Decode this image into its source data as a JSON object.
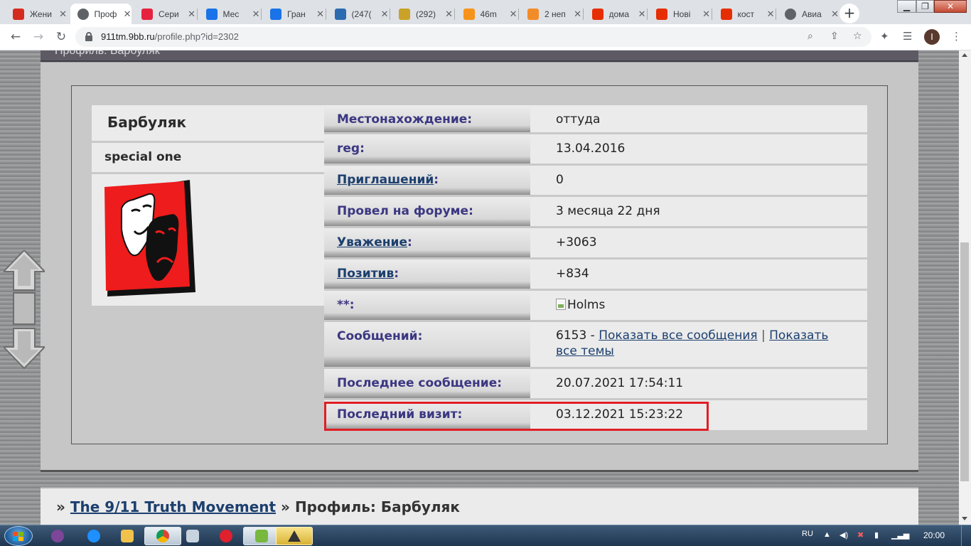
{
  "browser": {
    "tabs": [
      {
        "label": "Жени",
        "favicon": "flag-ru-icon",
        "color": "#d52b1e"
      },
      {
        "label": "Проф",
        "favicon": "globe-icon",
        "color": "#5f6368",
        "active": true
      },
      {
        "label": "Сери",
        "favicon": "ivi-icon",
        "color": "#e5233f"
      },
      {
        "label": "Мес",
        "favicon": "messenger-icon",
        "color": "#1a73e8"
      },
      {
        "label": "Гран",
        "favicon": "mail-at-icon",
        "color": "#1a73e8"
      },
      {
        "label": "(247(",
        "favicon": "mail-envelope-icon",
        "color": "#2b6cb0"
      },
      {
        "label": "(292)",
        "favicon": "shield-icon",
        "color": "#c9a227"
      },
      {
        "label": "46m",
        "favicon": "bitcoin-icon",
        "color": "#f7931a"
      },
      {
        "label": "2 неп",
        "favicon": "mail-envelope-icon",
        "color": "#f28c28"
      },
      {
        "label": "дома",
        "favicon": "aliexpress-icon",
        "color": "#e62e04"
      },
      {
        "label": "Нові",
        "favicon": "aliexpress-icon",
        "color": "#e62e04"
      },
      {
        "label": "кост",
        "favicon": "aliexpress-icon",
        "color": "#e62e04"
      },
      {
        "label": "Авиа",
        "favicon": "globe-icon",
        "color": "#5f6368"
      }
    ],
    "close_glyph": "✕",
    "new_tab_glyph": "+",
    "url_host": "911tm.9bb.ru",
    "url_path": "/profile.php?id=2302",
    "profile_initial": "I"
  },
  "profile_header": {
    "title": "Профиль: Барбуляк"
  },
  "profile": {
    "username": "Барбуляк",
    "user_title": "special one",
    "avatar_icon": "theatre-masks-icon"
  },
  "fields": {
    "location": {
      "label": "Местонахождение",
      "value": "оттуда"
    },
    "reg": {
      "label": "reg",
      "value": "13.04.2016"
    },
    "invites": {
      "label": "Приглашений",
      "value": "0"
    },
    "time_on_forum": {
      "label": "Провел на форуме",
      "value": "3 месяца 22 дня"
    },
    "respect": {
      "label": "Уважение",
      "value": "+3063"
    },
    "positive": {
      "label": "Позитив",
      "value": "+834"
    },
    "stars": {
      "label": "**",
      "value": "Holms"
    },
    "posts": {
      "label": "Сообщений",
      "count": "6153",
      "dash": " - ",
      "show_all_posts": "Показать все сообщения",
      "divider": " | ",
      "show_all_topics": "Показать все темы"
    },
    "last_post": {
      "label": "Последнее сообщение",
      "value": "20.07.2021 17:54:11"
    },
    "last_visit": {
      "label": "Последний визит",
      "value": "03.12.2021 15:23:22"
    },
    "colon": ":"
  },
  "breadcrumb": {
    "prefix": "»",
    "forum_link": "The 9/11 Truth Movement",
    "separator": "»",
    "current": "Профиль: Барбуляк"
  },
  "taskbar": {
    "lang": "RU",
    "clock": "20:00"
  }
}
